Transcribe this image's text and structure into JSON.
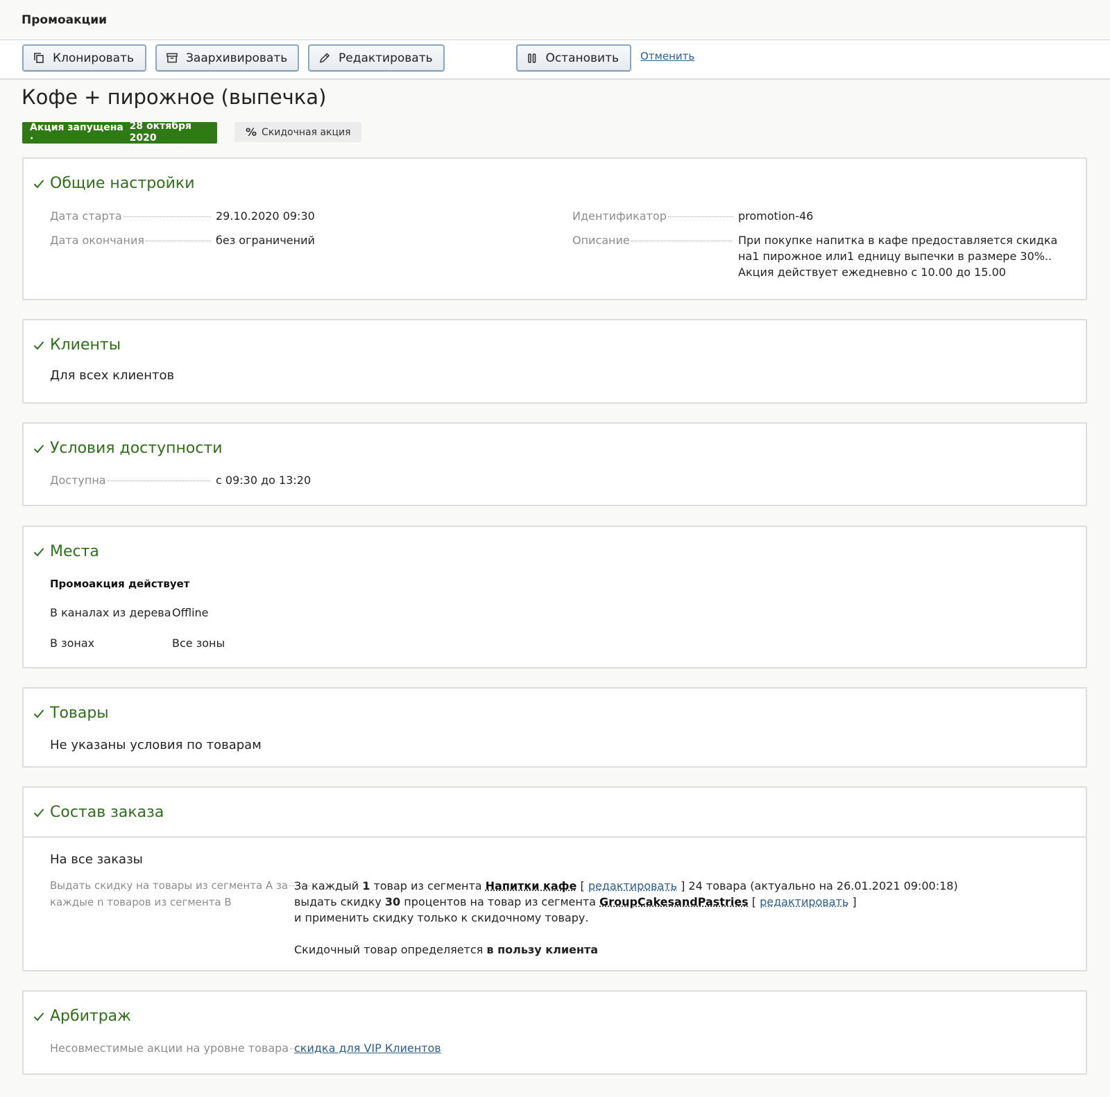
{
  "app": {
    "title": "Промоакции"
  },
  "toolbar": {
    "clone": "Клонировать",
    "archive": "Заархивировать",
    "edit": "Редактировать",
    "stop": "Остановить",
    "cancel": "Отменить"
  },
  "promo": {
    "title": "Кофе + пирожное (выпечка)",
    "status": "Акция запущена ·",
    "status_date": "28 октября 2020",
    "type_icon": "%",
    "type": "Скидочная акция"
  },
  "general": {
    "title": "Общие настройки",
    "start_label": "Дата старта",
    "start_value": "29.10.2020 09:30",
    "end_label": "Дата окончания",
    "end_value": "без ограничений",
    "id_label": "Идентификатор",
    "id_value": "promotion-46",
    "desc_label": "Описание",
    "desc_value": "При покупке напитка в кафе предоставляется скидка на1 пирожное или1 едницу выпечки в размере 30%.. Акция действует ежедневно с 10.00 до 15.00"
  },
  "clients": {
    "title": "Клиенты",
    "value": "Для всех клиентов"
  },
  "availability": {
    "title": "Условия доступности",
    "label": "Доступна",
    "value": "с 09:30 до 13:20"
  },
  "places": {
    "title": "Места",
    "subtitle": "Промоакция действует",
    "channels_label": "В каналах из дерева",
    "channels_value": "Offline",
    "zones_label": "В зонах",
    "zones_value": "Все зоны"
  },
  "goods": {
    "title": "Товары",
    "value": "Не указаны условия по товарам"
  },
  "order": {
    "title": "Состав заказа",
    "scope": "На все заказы",
    "rule_label_1": "Выдать скидку на товары из сегмента A за",
    "rule_label_2": "каждые n товаров из сегмента B",
    "l1_a": "За каждый ",
    "l1_count": "1",
    "l1_b": " товар из сегмента ",
    "l1_segment": "Напитки кафе",
    "bracket_open": "[ ",
    "edit_link": "редактировать",
    "bracket_close": " ]",
    "l1_c": " 24 товара (актуально на 26.01.2021 09:00:18)",
    "l2_a": "выдать скидку ",
    "l2_value": "30",
    "l2_b": " процентов на товар из сегмента ",
    "l2_segment": "GroupCakesandPastries",
    "l3": "и применить скидку только к скидочному товару.",
    "l4_a": "Скидочный товар определяется ",
    "l4_b": "в пользу клиента"
  },
  "arbitrage": {
    "title": "Арбитраж",
    "label": "Несовместимые акции на уровне товара",
    "value": "скидка для VIP Клиентов"
  },
  "colors": {
    "accent_green": "#2f7a14",
    "title_green": "#2f6e1a",
    "link_blue": "#2d5d88"
  }
}
